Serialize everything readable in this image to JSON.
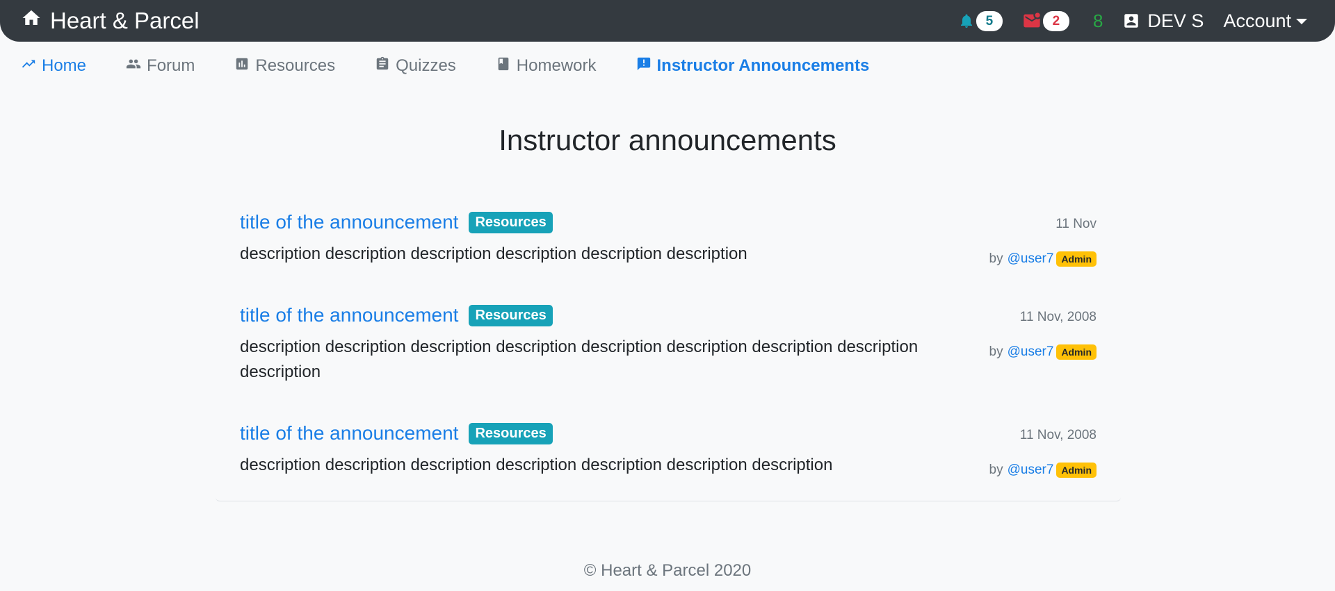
{
  "app": {
    "brand": "Heart & Parcel"
  },
  "header": {
    "notifications_count": "5",
    "messages_count": "2",
    "green_count": "8",
    "user_name": "DEV S",
    "account_label": "Account"
  },
  "nav": {
    "items": [
      {
        "label": "Home",
        "icon": "trending-up-icon"
      },
      {
        "label": "Forum",
        "icon": "people-icon"
      },
      {
        "label": "Resources",
        "icon": "bar-chart-icon"
      },
      {
        "label": "Quizzes",
        "icon": "clipboard-icon"
      },
      {
        "label": "Homework",
        "icon": "book-icon"
      },
      {
        "label": "Instructor Announcements",
        "icon": "announcement-icon"
      }
    ]
  },
  "main": {
    "title": "Instructor announcements",
    "announcements": [
      {
        "title": "title of the announcement",
        "tag": "Resources",
        "date": "11 Nov",
        "description": "description description description description description description",
        "by_label": "by",
        "author": "@user7",
        "role": "Admin"
      },
      {
        "title": "title of the announcement",
        "tag": "Resources",
        "date": "11 Nov, 2008",
        "description": "description description description description description description description description description",
        "by_label": "by",
        "author": "@user7",
        "role": "Admin"
      },
      {
        "title": "title of the announcement",
        "tag": "Resources",
        "date": "11 Nov, 2008",
        "description": "description description description description description description description",
        "by_label": "by",
        "author": "@user7",
        "role": "Admin"
      }
    ]
  },
  "footer": {
    "text": "© Heart & Parcel 2020"
  },
  "colors": {
    "navbar": "#343a40",
    "primary": "#1a7ee6",
    "tag": "#17a2b8",
    "admin_badge": "#ffc107",
    "notification": "#117a8b",
    "message": "#dc3545",
    "success": "#28a745"
  }
}
